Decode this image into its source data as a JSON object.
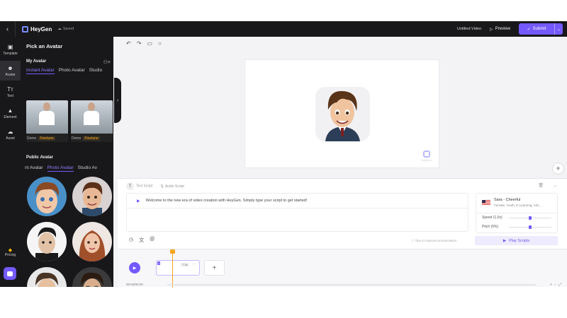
{
  "topbar": {
    "back_icon": "chevron-left-icon",
    "brand": "HeyGen",
    "saved": "Saved",
    "title": "Untitled Video",
    "preview": "Preview",
    "submit": "Submit"
  },
  "iconbar": {
    "items": [
      {
        "label": "Template",
        "icon": "template-icon"
      },
      {
        "label": "Avatar",
        "icon": "avatar-icon"
      },
      {
        "label": "Text",
        "icon": "text-icon"
      },
      {
        "label": "Element",
        "icon": "element-icon"
      },
      {
        "label": "Asset",
        "icon": "asset-icon"
      }
    ],
    "pricing": "Pricing"
  },
  "panel": {
    "title": "Pick an Avatar",
    "my_avatar": {
      "heading": "My Avatar",
      "tabs": [
        "Instant Avatar",
        "Photo Avatar",
        "Studio"
      ],
      "active_tab": "Instant Avatar",
      "cards": [
        {
          "demo": "Demo",
          "finetune": "Finetune"
        },
        {
          "demo": "Demo",
          "finetune": "Finetune"
        }
      ]
    },
    "public_avatar": {
      "heading": "Public Avatar",
      "tabs": [
        "nt Avatar",
        "Photo Avatar",
        "Studio Av"
      ],
      "active_tab": "Photo Avatar"
    }
  },
  "script": {
    "tab_text": "Text Script",
    "tab_audio": "Audio Script",
    "line": "Welcome to the new era of video creation with HeyGen. Simply type your script to get started!",
    "tip": "Tips to improve pronunciation",
    "play_scripts": "Play Scripts",
    "voice": {
      "name": "Sara - Cheerful",
      "desc": "Female, Youth, E-Learning, Adv...",
      "speed_label": "Speed (1.0x)",
      "speed_value": 0.5,
      "pitch_label": "Pitch (0%)",
      "pitch_value": 0.5
    }
  },
  "timeline": {
    "scene_number": "1",
    "scene_duration": "7.3s",
    "time": "00:02/00:00"
  },
  "watermark": "HeyGen",
  "colors": {
    "accent": "#7559ff",
    "dark": "#18181b",
    "playhead": "#f5a623"
  }
}
